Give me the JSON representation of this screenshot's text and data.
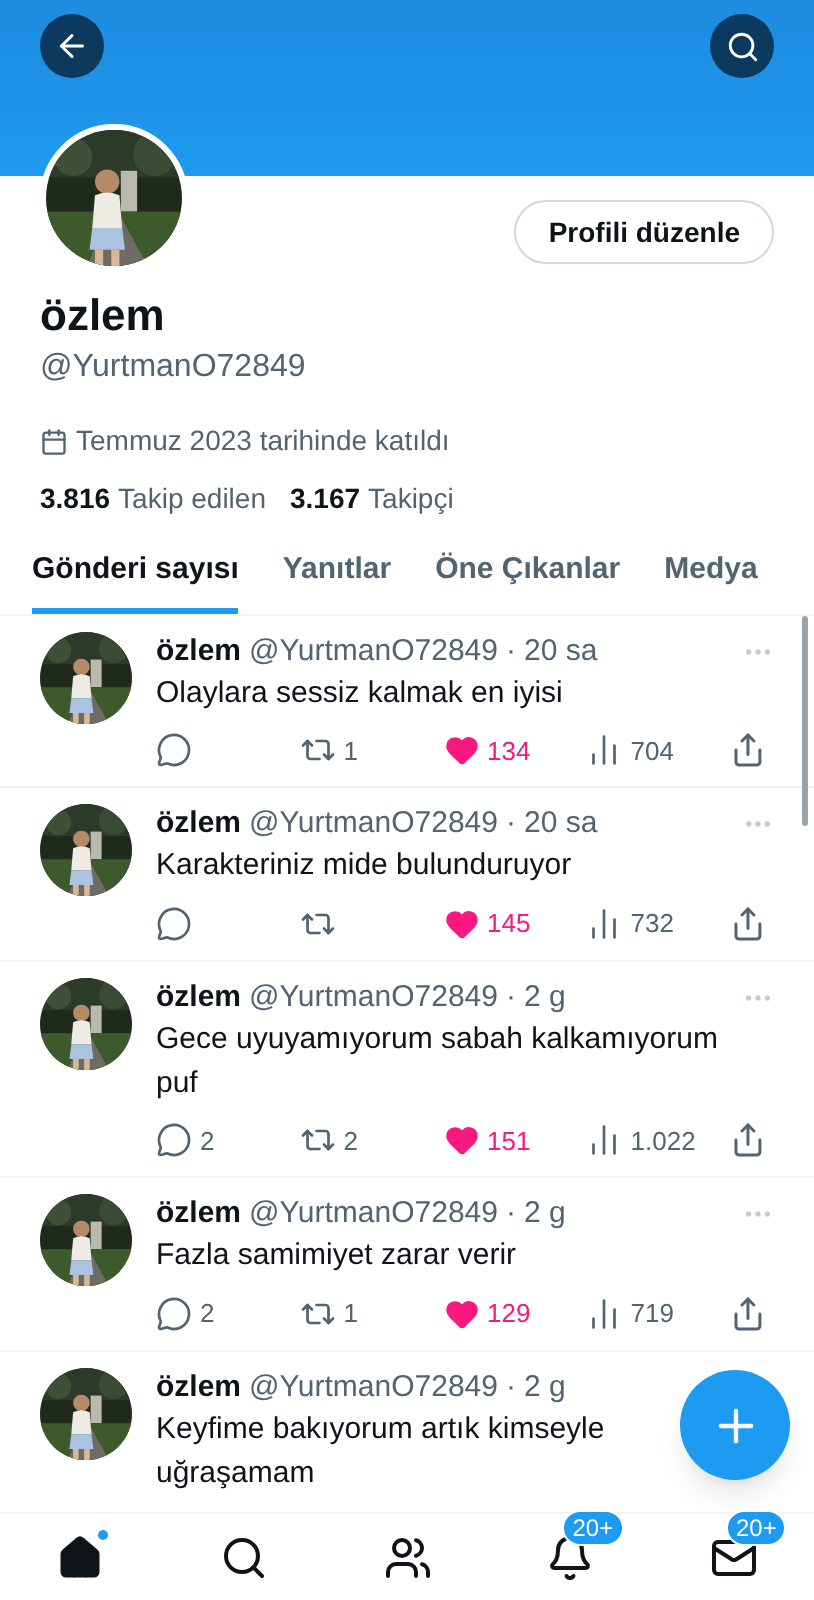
{
  "profile": {
    "name": "özlem",
    "handle": "@YurtmanO72849",
    "edit_button": "Profili düzenle",
    "joined": "Temmuz 2023 tarihinde katıldı",
    "following_count": "3.816",
    "following_label": "Takip edilen",
    "followers_count": "3.167",
    "followers_label": "Takipçi"
  },
  "tabs": [
    {
      "label": "Gönderi sayısı",
      "selected": true
    },
    {
      "label": "Yanıtlar",
      "selected": false
    },
    {
      "label": "Öne Çıkanlar",
      "selected": false
    },
    {
      "label": "Medya",
      "selected": false
    }
  ],
  "posts": [
    {
      "name": "özlem",
      "handle": "@YurtmanO72849",
      "separator": "·",
      "time": "20 sa",
      "text": "Olaylara sessiz kalmak en iyisi",
      "actions": {
        "reposts": "1",
        "likes": "134",
        "liked": true,
        "views": "704"
      }
    },
    {
      "name": "özlem",
      "handle": "@YurtmanO72849",
      "separator": "·",
      "time": "20 sa",
      "text": "Karakteriniz mide bulunduruyor",
      "actions": {
        "likes": "145",
        "liked": true,
        "views": "732"
      }
    },
    {
      "name": "özlem",
      "handle": "@YurtmanO72849",
      "separator": "·",
      "time": "2 g",
      "text": "Gece uyuyamıyorum sabah kalkamıyorum puf",
      "actions": {
        "replies": "2",
        "reposts": "2",
        "likes": "151",
        "liked": true,
        "views": "1.022"
      }
    },
    {
      "name": "özlem",
      "handle": "@YurtmanO72849",
      "separator": "·",
      "time": "2 g",
      "text": "Fazla samimiyet zarar verir",
      "actions": {
        "replies": "2",
        "reposts": "1",
        "likes": "129",
        "liked": true,
        "views": "719"
      }
    },
    {
      "name": "özlem",
      "handle": "@YurtmanO72849",
      "separator": "·",
      "time": "2 g",
      "text": "Keyfime bakıyorum artık kimseyle uğraşamam"
    }
  ],
  "bottom_nav": [
    {
      "kind": "home",
      "selected": true,
      "dot": true
    },
    {
      "kind": "search",
      "selected": false
    },
    {
      "kind": "people",
      "selected": false
    },
    {
      "kind": "bell",
      "selected": false,
      "badge": "20+"
    },
    {
      "kind": "mail",
      "selected": false,
      "badge": "20+"
    }
  ]
}
